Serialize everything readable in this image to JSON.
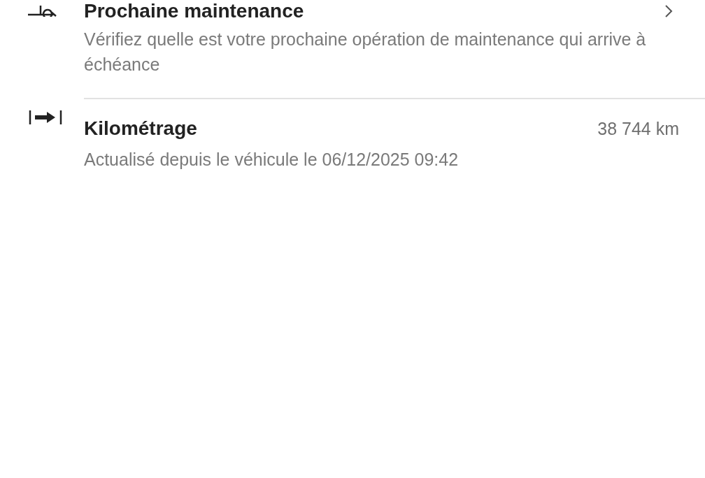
{
  "items": [
    {
      "kind": "maintenance",
      "title": "Prochaine maintenance",
      "description": "Vérifiez quelle est votre prochaine opération de maintenance qui arrive à échéance",
      "chevron": true
    },
    {
      "kind": "mileage",
      "title": "Kilométrage",
      "value": "38 744 km",
      "description": "Actualisé depuis le véhicule le 06/12/2025 09:42",
      "chevron": false
    }
  ]
}
